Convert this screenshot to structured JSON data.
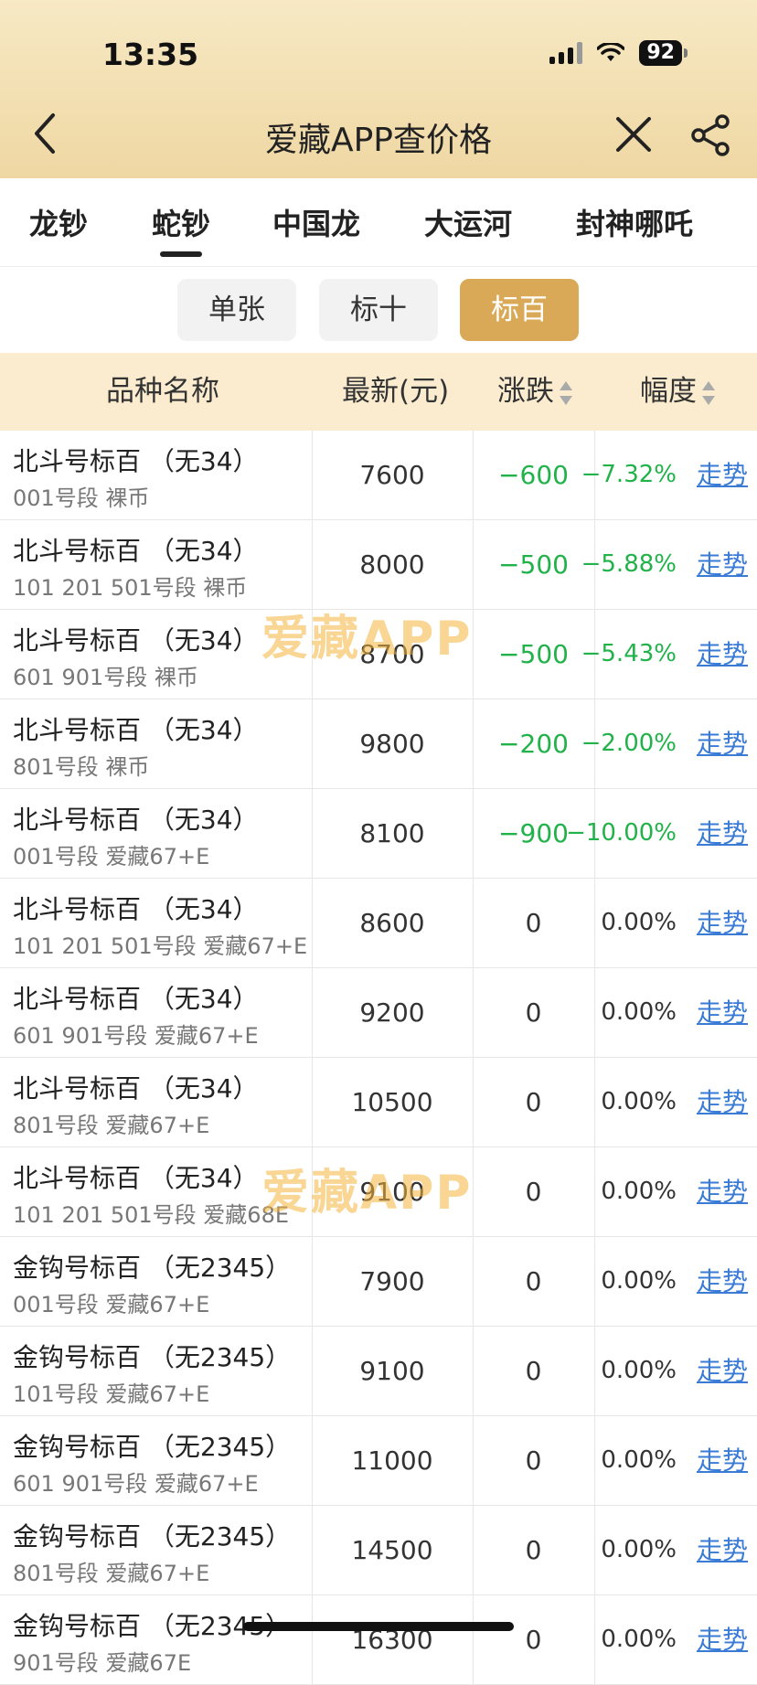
{
  "status": {
    "time": "13:35",
    "battery": "92"
  },
  "nav": {
    "title": "爱藏APP查价格"
  },
  "tabs": [
    "龙钞",
    "蛇钞",
    "中国龙",
    "大运河",
    "封神哪吒"
  ],
  "segments": [
    "单张",
    "标十",
    "标百"
  ],
  "table_header": {
    "name": "品种名称",
    "price": "最新(元)",
    "change": "涨跌",
    "pct": "幅度"
  },
  "watermark": "爱藏APP",
  "rows": [
    {
      "name": "北斗号标百  （无34）",
      "sub": "001号段 裸币",
      "price": "7600",
      "change": "−600",
      "pct": "−7.32%",
      "trend": "走势"
    },
    {
      "name": "北斗号标百  （无34）",
      "sub": "101 201 501号段 裸币",
      "price": "8000",
      "change": "−500",
      "pct": "−5.88%",
      "trend": "走势"
    },
    {
      "name": "北斗号标百  （无34）",
      "sub": "601 901号段 裸币",
      "price": "8700",
      "change": "−500",
      "pct": "−5.43%",
      "trend": "走势"
    },
    {
      "name": "北斗号标百  （无34）",
      "sub": "801号段 裸币",
      "price": "9800",
      "change": "−200",
      "pct": "−2.00%",
      "trend": "走势"
    },
    {
      "name": "北斗号标百  （无34）",
      "sub": "001号段 爱藏67+E",
      "price": "8100",
      "change": "−900",
      "pct": "−10.00%",
      "trend": "走势"
    },
    {
      "name": "北斗号标百  （无34）",
      "sub": "101 201 501号段 爱藏67+E",
      "price": "8600",
      "change": "0",
      "pct": "0.00%",
      "trend": "走势"
    },
    {
      "name": "北斗号标百  （无34）",
      "sub": "601 901号段 爱藏67+E",
      "price": "9200",
      "change": "0",
      "pct": "0.00%",
      "trend": "走势"
    },
    {
      "name": "北斗号标百  （无34）",
      "sub": "801号段 爱藏67+E",
      "price": "10500",
      "change": "0",
      "pct": "0.00%",
      "trend": "走势"
    },
    {
      "name": "北斗号标百  （无34）",
      "sub": "101 201 501号段 爱藏68E",
      "price": "9100",
      "change": "0",
      "pct": "0.00%",
      "trend": "走势"
    },
    {
      "name": "金钩号标百  （无2345）",
      "sub": "001号段 爱藏67+E",
      "price": "7900",
      "change": "0",
      "pct": "0.00%",
      "trend": "走势"
    },
    {
      "name": "金钩号标百  （无2345）",
      "sub": "101号段 爱藏67+E",
      "price": "9100",
      "change": "0",
      "pct": "0.00%",
      "trend": "走势"
    },
    {
      "name": "金钩号标百  （无2345）",
      "sub": "601 901号段 爱藏67+E",
      "price": "11000",
      "change": "0",
      "pct": "0.00%",
      "trend": "走势"
    },
    {
      "name": "金钩号标百  （无2345）",
      "sub": "801号段 爱藏67+E",
      "price": "14500",
      "change": "0",
      "pct": "0.00%",
      "trend": "走势"
    },
    {
      "name": "金钩号标百  （无2345）",
      "sub": "901号段 爱藏67E",
      "price": "16300",
      "change": "0",
      "pct": "0.00%",
      "trend": "走势"
    }
  ],
  "colors": {
    "accent": "#d9a958",
    "negative": "#21b24a",
    "link": "#3a7bd5",
    "header_bg": "#fbecd0"
  }
}
